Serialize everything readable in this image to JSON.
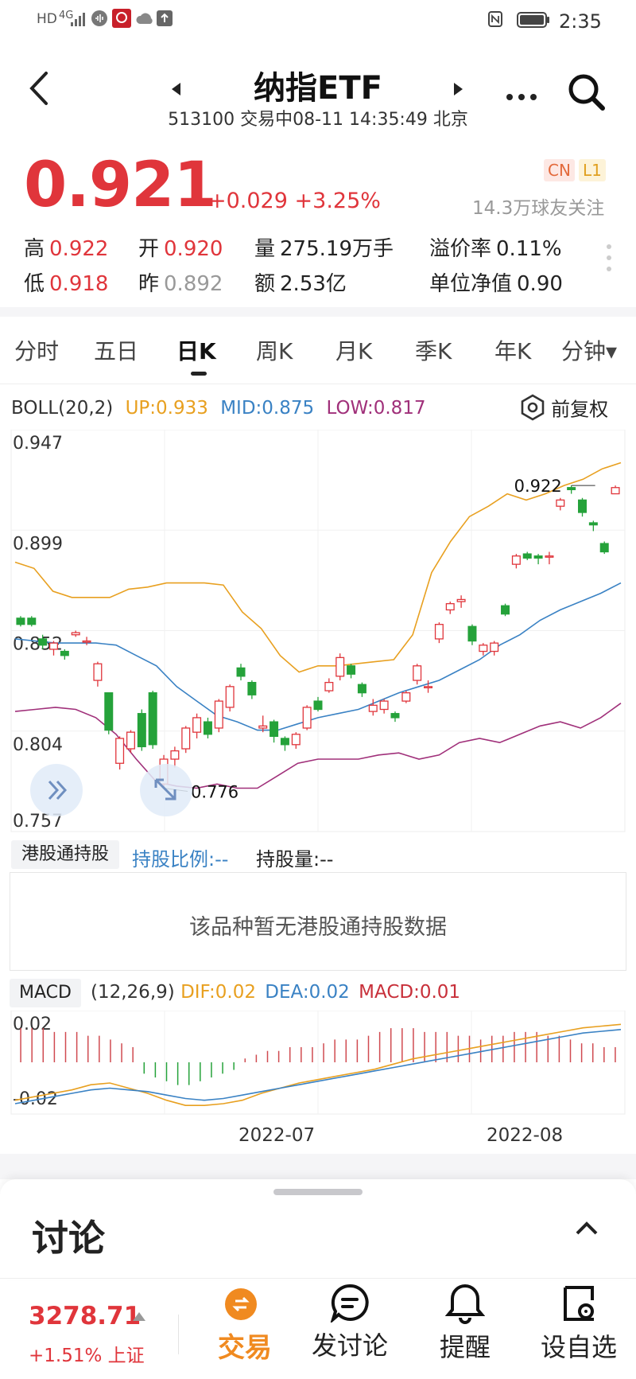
{
  "status_bar": {
    "left_icons": [
      "HD",
      "4G",
      "signal-icon",
      "audio-icon",
      "app-icon",
      "cloud-icon",
      "upload-icon"
    ],
    "time": "2:35"
  },
  "header": {
    "title": "纳指ETF",
    "subtitle": "513100 交易中08-11 14:35:49 北京"
  },
  "quote": {
    "price": "0.921",
    "change": "+0.029",
    "change_pct": "+3.25%",
    "tag_cn": "CN",
    "tag_l1": "L1",
    "followers": "14.3万球友关注",
    "high_label": "高",
    "high": "0.922",
    "open_label": "开",
    "open": "0.920",
    "volume_label": "量",
    "volume": "275.19万手",
    "premium_label": "溢价率",
    "premium": "0.11%",
    "low_label": "低",
    "low": "0.918",
    "prev_label": "昨",
    "prev": "0.892",
    "amount_label": "额",
    "amount": "2.53亿",
    "nav_label": "单位净值",
    "nav": "0.90"
  },
  "tabs": [
    "分时",
    "五日",
    "日K",
    "周K",
    "月K",
    "季K",
    "年K",
    "分钟▾"
  ],
  "boll": {
    "label": "BOLL(20,2)",
    "up": "UP:0.933",
    "mid": "MID:0.875",
    "low": "LOW:0.817",
    "adjust": "前复权",
    "colors": {
      "up": "#e8a020",
      "mid": "#3a82c4",
      "low": "#a0307a"
    }
  },
  "chart_data": [
    {
      "type": "candlestick",
      "y_ticks": [
        "0.947",
        "0.899",
        "0.852",
        "0.804",
        "0.757"
      ],
      "ylim": [
        0.757,
        0.947
      ],
      "annotations": [
        "0.922",
        "0.776"
      ],
      "candles": [
        {
          "o": 0.858,
          "c": 0.855,
          "h": 0.859,
          "l": 0.854
        },
        {
          "o": 0.858,
          "c": 0.855,
          "h": 0.859,
          "l": 0.854
        },
        {
          "o": 0.848,
          "c": 0.845,
          "h": 0.85,
          "l": 0.843
        },
        {
          "o": 0.843,
          "c": 0.846,
          "h": 0.847,
          "l": 0.84
        },
        {
          "o": 0.842,
          "c": 0.84,
          "h": 0.843,
          "l": 0.838
        },
        {
          "o": 0.85,
          "c": 0.851,
          "h": 0.852,
          "l": 0.849
        },
        {
          "o": 0.847,
          "c": 0.847,
          "h": 0.849,
          "l": 0.845
        },
        {
          "o": 0.828,
          "c": 0.836,
          "h": 0.837,
          "l": 0.825
        },
        {
          "o": 0.822,
          "c": 0.804,
          "h": 0.822,
          "l": 0.802
        },
        {
          "o": 0.788,
          "c": 0.8,
          "h": 0.801,
          "l": 0.785
        },
        {
          "o": 0.795,
          "c": 0.803,
          "h": 0.804,
          "l": 0.793
        },
        {
          "o": 0.812,
          "c": 0.796,
          "h": 0.814,
          "l": 0.794
        },
        {
          "o": 0.822,
          "c": 0.797,
          "h": 0.823,
          "l": 0.795
        },
        {
          "o": 0.778,
          "c": 0.79,
          "h": 0.792,
          "l": 0.776
        },
        {
          "o": 0.79,
          "c": 0.794,
          "h": 0.796,
          "l": 0.786
        },
        {
          "o": 0.795,
          "c": 0.805,
          "h": 0.806,
          "l": 0.793
        },
        {
          "o": 0.803,
          "c": 0.81,
          "h": 0.812,
          "l": 0.8
        },
        {
          "o": 0.808,
          "c": 0.802,
          "h": 0.81,
          "l": 0.8
        },
        {
          "o": 0.805,
          "c": 0.818,
          "h": 0.819,
          "l": 0.803
        },
        {
          "o": 0.815,
          "c": 0.825,
          "h": 0.826,
          "l": 0.813
        },
        {
          "o": 0.834,
          "c": 0.83,
          "h": 0.836,
          "l": 0.828
        },
        {
          "o": 0.827,
          "c": 0.821,
          "h": 0.828,
          "l": 0.819
        },
        {
          "o": 0.805,
          "c": 0.806,
          "h": 0.811,
          "l": 0.803
        },
        {
          "o": 0.808,
          "c": 0.801,
          "h": 0.809,
          "l": 0.798
        },
        {
          "o": 0.8,
          "c": 0.797,
          "h": 0.801,
          "l": 0.794
        },
        {
          "o": 0.797,
          "c": 0.802,
          "h": 0.803,
          "l": 0.795
        },
        {
          "o": 0.805,
          "c": 0.815,
          "h": 0.816,
          "l": 0.804
        },
        {
          "o": 0.818,
          "c": 0.814,
          "h": 0.82,
          "l": 0.813
        },
        {
          "o": 0.823,
          "c": 0.827,
          "h": 0.829,
          "l": 0.822
        },
        {
          "o": 0.83,
          "c": 0.839,
          "h": 0.841,
          "l": 0.828
        },
        {
          "o": 0.835,
          "c": 0.831,
          "h": 0.836,
          "l": 0.829
        },
        {
          "o": 0.826,
          "c": 0.822,
          "h": 0.827,
          "l": 0.82
        },
        {
          "o": 0.813,
          "c": 0.816,
          "h": 0.819,
          "l": 0.811
        },
        {
          "o": 0.814,
          "c": 0.818,
          "h": 0.819,
          "l": 0.812
        },
        {
          "o": 0.812,
          "c": 0.81,
          "h": 0.813,
          "l": 0.808
        },
        {
          "o": 0.818,
          "c": 0.822,
          "h": 0.823,
          "l": 0.817
        },
        {
          "o": 0.828,
          "c": 0.835,
          "h": 0.836,
          "l": 0.826
        },
        {
          "o": 0.825,
          "c": 0.825,
          "h": 0.828,
          "l": 0.822
        },
        {
          "o": 0.848,
          "c": 0.855,
          "h": 0.856,
          "l": 0.846
        },
        {
          "o": 0.862,
          "c": 0.865,
          "h": 0.866,
          "l": 0.86
        },
        {
          "o": 0.866,
          "c": 0.867,
          "h": 0.869,
          "l": 0.863
        },
        {
          "o": 0.854,
          "c": 0.847,
          "h": 0.855,
          "l": 0.845
        },
        {
          "o": 0.842,
          "c": 0.845,
          "h": 0.846,
          "l": 0.84
        },
        {
          "o": 0.842,
          "c": 0.846,
          "h": 0.847,
          "l": 0.84
        },
        {
          "o": 0.864,
          "c": 0.86,
          "h": 0.865,
          "l": 0.859
        },
        {
          "o": 0.884,
          "c": 0.888,
          "h": 0.889,
          "l": 0.882
        },
        {
          "o": 0.889,
          "c": 0.887,
          "h": 0.89,
          "l": 0.886
        },
        {
          "o": 0.888,
          "c": 0.887,
          "h": 0.889,
          "l": 0.884
        },
        {
          "o": 0.888,
          "c": 0.888,
          "h": 0.89,
          "l": 0.884
        },
        {
          "o": 0.912,
          "c": 0.915,
          "h": 0.916,
          "l": 0.91
        },
        {
          "o": 0.921,
          "c": 0.92,
          "h": 0.922,
          "l": 0.918
        },
        {
          "o": 0.915,
          "c": 0.909,
          "h": 0.916,
          "l": 0.907
        },
        {
          "o": 0.904,
          "c": 0.903,
          "h": 0.905,
          "l": 0.9
        },
        {
          "o": 0.894,
          "c": 0.89,
          "h": 0.895,
          "l": 0.889
        },
        {
          "o": 0.918,
          "c": 0.921,
          "h": 0.922,
          "l": 0.918
        }
      ],
      "boll_up": [
        0.885,
        0.882,
        0.871,
        0.868,
        0.868,
        0.868,
        0.872,
        0.873,
        0.875,
        0.875,
        0.875,
        0.874,
        0.861,
        0.853,
        0.84,
        0.832,
        0.835,
        0.835,
        0.836,
        0.837,
        0.838,
        0.85,
        0.88,
        0.895,
        0.907,
        0.912,
        0.918,
        0.915,
        0.918,
        0.922,
        0.925,
        0.93,
        0.933
      ],
      "boll_mid": [
        0.848,
        0.847,
        0.846,
        0.846,
        0.846,
        0.845,
        0.84,
        0.835,
        0.825,
        0.818,
        0.811,
        0.808,
        0.804,
        0.804,
        0.807,
        0.81,
        0.812,
        0.814,
        0.818,
        0.822,
        0.825,
        0.828,
        0.833,
        0.838,
        0.845,
        0.85,
        0.857,
        0.862,
        0.866,
        0.87,
        0.875
      ],
      "boll_low": [
        0.813,
        0.814,
        0.815,
        0.814,
        0.81,
        0.802,
        0.79,
        0.779,
        0.777,
        0.776,
        0.778,
        0.776,
        0.776,
        0.782,
        0.788,
        0.79,
        0.79,
        0.79,
        0.792,
        0.793,
        0.79,
        0.792,
        0.798,
        0.8,
        0.798,
        0.802,
        0.806,
        0.808,
        0.805,
        0.81,
        0.817
      ]
    },
    {
      "type": "macd",
      "y_ticks": [
        "0.02",
        "-0.02"
      ],
      "ylim": [
        -0.03,
        0.03
      ],
      "x_labels": [
        "2022-07",
        "2022-08"
      ],
      "dif": [
        -0.022,
        -0.02,
        -0.018,
        -0.016,
        -0.013,
        -0.012,
        -0.015,
        -0.018,
        -0.022,
        -0.025,
        -0.025,
        -0.024,
        -0.022,
        -0.018,
        -0.015,
        -0.012,
        -0.01,
        -0.008,
        -0.006,
        -0.004,
        -0.001,
        0.002,
        0.004,
        0.006,
        0.008,
        0.01,
        0.012,
        0.014,
        0.016,
        0.018,
        0.02,
        0.021,
        0.022
      ],
      "dea": [
        -0.024,
        -0.022,
        -0.02,
        -0.018,
        -0.016,
        -0.015,
        -0.016,
        -0.017,
        -0.019,
        -0.021,
        -0.022,
        -0.021,
        -0.019,
        -0.017,
        -0.015,
        -0.013,
        -0.011,
        -0.009,
        -0.007,
        -0.005,
        -0.003,
        -0.001,
        0.001,
        0.003,
        0.005,
        0.007,
        0.009,
        0.011,
        0.013,
        0.015,
        0.017,
        0.018,
        0.019
      ],
      "macd": [
        0.009,
        0.009,
        0.009,
        0.008,
        0.008,
        0.008,
        0.007,
        0.007,
        0.006,
        0.005,
        0.004,
        -0.003,
        -0.004,
        -0.005,
        -0.006,
        -0.006,
        -0.005,
        -0.004,
        -0.003,
        -0.002,
        0.001,
        0.002,
        0.003,
        0.003,
        0.004,
        0.004,
        0.004,
        0.005,
        0.006,
        0.006,
        0.006,
        0.007,
        0.008,
        0.009,
        0.009,
        0.009,
        0.008,
        0.008,
        0.008,
        0.007,
        0.007,
        0.006,
        0.007,
        0.007,
        0.008,
        0.008,
        0.008,
        0.007,
        0.007,
        0.006,
        0.005,
        0.005,
        0.004,
        0.004
      ]
    }
  ],
  "hk": {
    "label": "港股通持股",
    "ratio": "持股比例:--",
    "qty": "持股量:--",
    "empty": "该品种暂无港股通持股数据"
  },
  "macd_legend": {
    "label": "MACD",
    "params": "(12,26,9)",
    "dif": "DIF:0.02",
    "dea": "DEA:0.02",
    "macd": "MACD:0.01"
  },
  "discussion": {
    "title": "讨论"
  },
  "bottom": {
    "index_value": "3278.71",
    "index_change": "+1.51% 上证",
    "trade": "交易",
    "post": "发讨论",
    "remind": "提醒",
    "watch": "设自选"
  }
}
